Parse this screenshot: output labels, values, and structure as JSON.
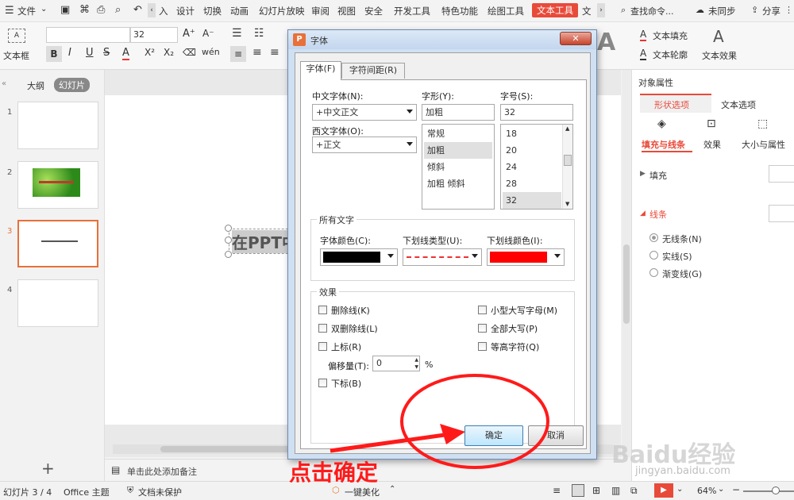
{
  "topbar": {
    "menu_icon": "hamburger-icon",
    "file": "文件",
    "tabs": [
      "入",
      "设计",
      "切换",
      "动画",
      "幻灯片放映",
      "审阅",
      "视图",
      "安全",
      "开发工具",
      "特色功能",
      "绘图工具",
      "文本工具",
      "文"
    ],
    "active_tab": "文本工具",
    "search": "查找命令...",
    "sync": "未同步",
    "share": "分享"
  },
  "ribbon": {
    "textbox": "文本框",
    "font_size": "32",
    "text_fill": "文本填充",
    "text_outline": "文本轮廓",
    "text_effect": "文本效果"
  },
  "sidebar": {
    "tab_outline": "大纲",
    "tab_slides": "幻灯片",
    "slide_numbers": [
      "1",
      "2",
      "3",
      "4"
    ],
    "add_icon": "plus-icon"
  },
  "slide": {
    "text": "在PPT中"
  },
  "notes": {
    "placeholder": "单击此处添加备注"
  },
  "right_panel": {
    "title": "对象属性",
    "tabs": [
      "形状选项",
      "文本选项"
    ],
    "subtabs": [
      "填充与线条",
      "效果",
      "大小与属性"
    ],
    "fill": "填充",
    "line": "线条",
    "line_options": [
      "无线条(N)",
      "实线(S)",
      "渐变线(G)"
    ]
  },
  "dialog": {
    "title": "字体",
    "tabs": [
      "字体(F)",
      "字符间距(R)"
    ],
    "cn_font_label": "中文字体(N):",
    "cn_font_value": "+中文正文",
    "style_label": "字形(Y):",
    "style_value": "加粗",
    "size_label": "字号(S):",
    "size_value": "32",
    "west_font_label": "西文字体(O):",
    "west_font_value": "+正文",
    "style_list": [
      "常规",
      "加粗",
      "倾斜",
      "加粗 倾斜"
    ],
    "size_list": [
      "18",
      "20",
      "24",
      "28",
      "32"
    ],
    "all_text": "所有文字",
    "font_color_label": "字体颜色(C):",
    "underline_type_label": "下划线类型(U):",
    "underline_color_label": "下划线颜色(I):",
    "font_color": "#000000",
    "underline_color": "#ff0000",
    "effects": "效果",
    "strike": "删除线(K)",
    "double_strike": "双删除线(L)",
    "superscript": "上标(R)",
    "offset_label": "偏移量(T):",
    "offset_value": "0",
    "percent": "%",
    "subscript": "下标(B)",
    "small_caps": "小型大写字母(M)",
    "all_caps": "全部大写(P)",
    "equal_height": "等高字符(Q)",
    "ok": "确定",
    "cancel": "取消"
  },
  "annotation": {
    "text": "点击确定"
  },
  "status": {
    "slide_info": "幻灯片 3 / 4",
    "theme": "Office 主题",
    "protect": "文档未保护",
    "beautify": "一键美化",
    "zoom": "64%"
  },
  "watermark": {
    "brand": "Baidu经验",
    "url": "jingyan.baidu.com"
  }
}
